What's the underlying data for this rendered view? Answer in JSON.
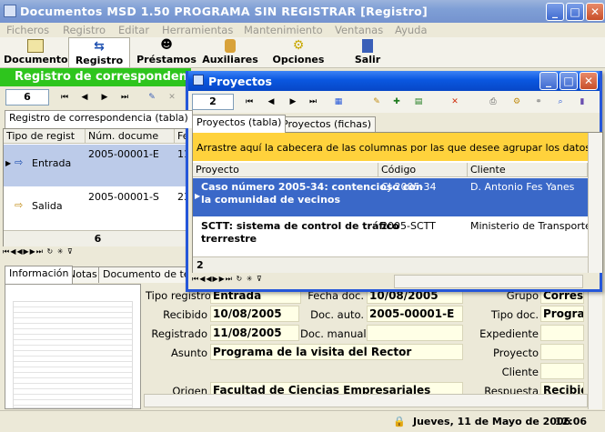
{
  "window": {
    "title": "Documentos MSD 1.50 PROGRAMA SIN REGISTRAR [Registro]",
    "min": "_",
    "max": "□",
    "close": "✕"
  },
  "menu": [
    "Ficheros",
    "Registro",
    "Editar",
    "Herramientas",
    "Mantenimiento",
    "Ventanas",
    "Ayuda"
  ],
  "toolbar": [
    "Documentos",
    "Registro",
    "Préstamos",
    "Auxiliares",
    "Opciones",
    "Salir"
  ],
  "registro": {
    "header": "Registro de correspondencia",
    "count": "6",
    "tabs": [
      "Registro de correspondencia (tabla)",
      "Re"
    ],
    "columns": [
      "Tipo de regist",
      "Núm. docume",
      "Fe"
    ],
    "rows": [
      {
        "tipo": "Entrada",
        "num": "2005-00001-E",
        "fe": "11"
      },
      {
        "tipo": "Salida",
        "num": "2005-00001-S",
        "fe": "23"
      }
    ],
    "footer_count": "6"
  },
  "detail": {
    "tabs": [
      "Información",
      "Notas",
      "Documento de text"
    ],
    "labels": {
      "tipo": "Tipo registro",
      "fecha": "Fecha doc.",
      "grupo": "Grupo",
      "recibido": "Recibido",
      "auto": "Doc. auto.",
      "tipodoc": "Tipo doc.",
      "registrado": "Registrado",
      "manual": "Doc. manual",
      "expediente": "Expediente",
      "asunto": "Asunto",
      "proyecto": "Proyecto",
      "cliente": "Cliente",
      "origen": "Origen",
      "respuesta": "Respuesta"
    },
    "values": {
      "tipo": "Entrada",
      "fecha": "10/08/2005",
      "grupo": "Corresp",
      "recibido": "10/08/2005",
      "auto": "2005-00001-E",
      "tipodoc": "Progran",
      "registrado": "11/08/2005",
      "manual": "",
      "expediente": "",
      "asunto": "Programa de la visita del Rector",
      "proyecto": "",
      "cliente": "",
      "origen": "Facultad de Ciencias Empresariales",
      "respuesta": "Recibid"
    }
  },
  "status": {
    "date": "Jueves, 11 de Mayo de 2006",
    "time": "12:06"
  },
  "proyectos": {
    "title": "Proyectos",
    "count": "2",
    "tabs": [
      "Proyectos (tabla)",
      "Proyectos (fichas)"
    ],
    "group_hint": "Arrastre aquí la cabecera de las columnas por las que desee agrupar los datos",
    "columns": [
      "Proyecto",
      "Código",
      "Cliente"
    ],
    "rows": [
      {
        "proyecto": "Caso número 2005-34: contencioso con",
        "proyecto2": "la comunidad de vecinos",
        "codigo": "CJ-2005-34",
        "cliente": "D. Antonio Fes Yanes"
      },
      {
        "proyecto": "SCTT: sistema de control de tráfico",
        "proyecto2": "trerrestre",
        "codigo": "2005-SCTT",
        "cliente": "Ministerio de Transportes"
      }
    ],
    "footer_count": "2"
  },
  "colors": {
    "green": "#2ec51d",
    "xp_blue": "#0a57e0",
    "selected": "#3a68c8",
    "yellow": "#ffd23c"
  }
}
